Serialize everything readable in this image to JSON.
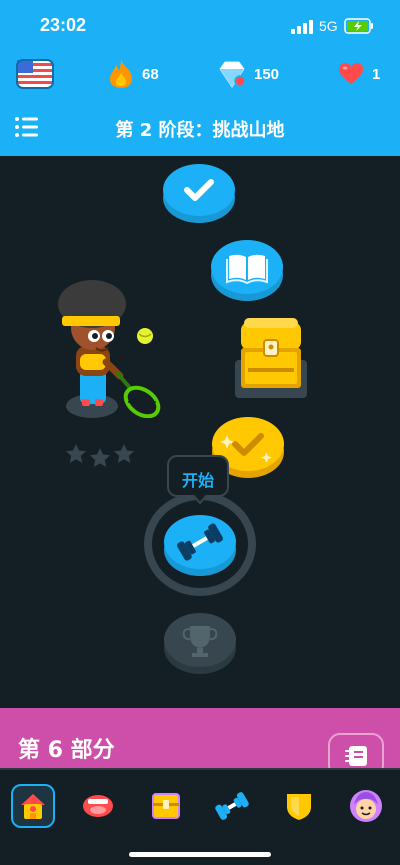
{
  "status_bar": {
    "time": "23:02",
    "network": "5G"
  },
  "stats": {
    "streak": "68",
    "gems": "150",
    "hearts": "1"
  },
  "unit_header": {
    "title": "第 2 阶段：挑战山地"
  },
  "path": {
    "start_tooltip": "开始",
    "character_stars_earned": 0,
    "character_stars_total": 3,
    "nodes": [
      {
        "kind": "completed-lesson",
        "icon": "check-icon"
      },
      {
        "kind": "story",
        "icon": "book-icon"
      },
      {
        "kind": "treasure-chest",
        "icon": "chest-icon"
      },
      {
        "kind": "completed-challenge",
        "icon": "check-icon"
      },
      {
        "kind": "practice-current",
        "icon": "dumbbell-icon"
      },
      {
        "kind": "unit-trophy-locked",
        "icon": "trophy-icon"
      }
    ]
  },
  "section_banner": {
    "title": "第 6 部分"
  },
  "bottom_nav": [
    {
      "id": "home",
      "icon": "home-icon",
      "active": true
    },
    {
      "id": "speaking",
      "icon": "mouth-icon",
      "active": false
    },
    {
      "id": "treasure",
      "icon": "chest-icon",
      "active": false
    },
    {
      "id": "practice",
      "icon": "dumbbell-icon",
      "active": false
    },
    {
      "id": "leagues",
      "icon": "shield-icon",
      "active": false
    },
    {
      "id": "profile",
      "icon": "profile-avatar-icon",
      "active": false
    }
  ],
  "colors": {
    "header_blue": "#1cb0f6",
    "path_background": "#131f24",
    "section_pink": "#ce4fa9",
    "gold": "#ffc800",
    "locked_gray": "#37464f"
  }
}
